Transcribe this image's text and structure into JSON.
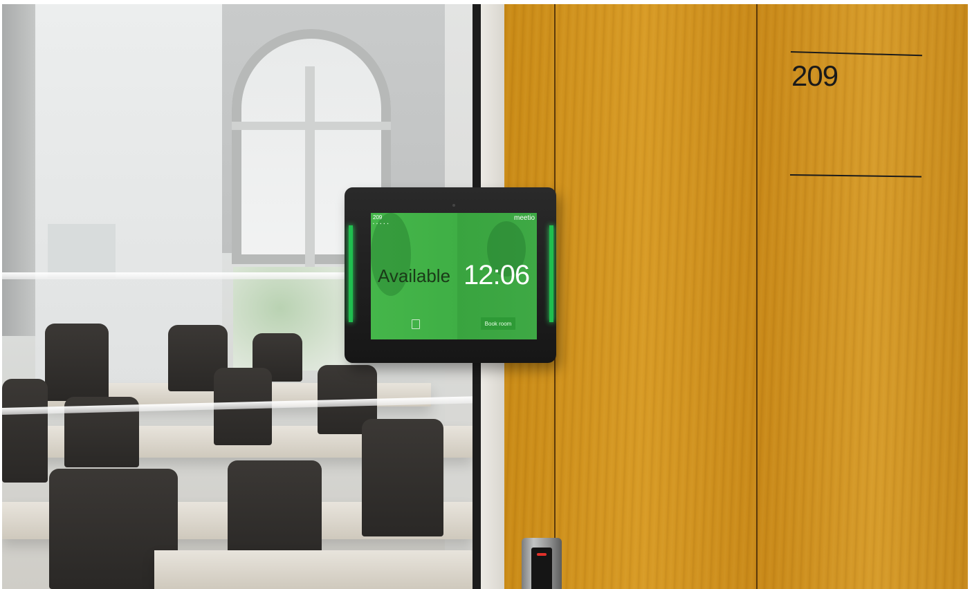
{
  "door_sign": {
    "room_number": "209"
  },
  "tablet": {
    "room_label": "209",
    "brand": "meetio",
    "status": "Available",
    "time": "12:06",
    "book_button_label": "Book room",
    "status_color": "#3faf45",
    "calendar_icon": "calendar-icon"
  },
  "colors": {
    "wood": "#d08f1e",
    "available_green": "#45b64a",
    "reader_led": "#e0302a"
  }
}
